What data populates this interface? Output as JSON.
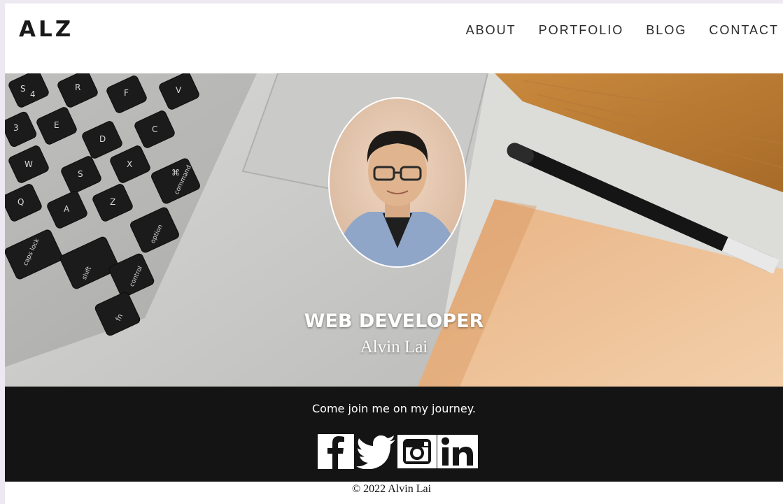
{
  "header": {
    "logo": "ALZ",
    "nav": [
      {
        "label": "ABOUT"
      },
      {
        "label": "PORTFOLIO"
      },
      {
        "label": "BLOG"
      },
      {
        "label": "CONTACT"
      }
    ]
  },
  "hero": {
    "role": "WEB DEVELOPER",
    "name": "Alvin Lai"
  },
  "footer": {
    "tagline": "Come join me on my journey.",
    "socials": [
      {
        "icon": "facebook-icon"
      },
      {
        "icon": "twitter-icon"
      },
      {
        "icon": "instagram-icon"
      },
      {
        "icon": "linkedin-icon"
      }
    ],
    "copyright": "© 2022 Alvin Lai"
  },
  "keyboard_keys": [
    "S",
    "4",
    "R",
    "F",
    "V",
    "3",
    "E",
    "D",
    "C",
    "W",
    "S",
    "X",
    "⌘",
    "command",
    "Q",
    "A",
    "Z",
    "option",
    "caps lock",
    "shift",
    "control",
    "fn"
  ]
}
